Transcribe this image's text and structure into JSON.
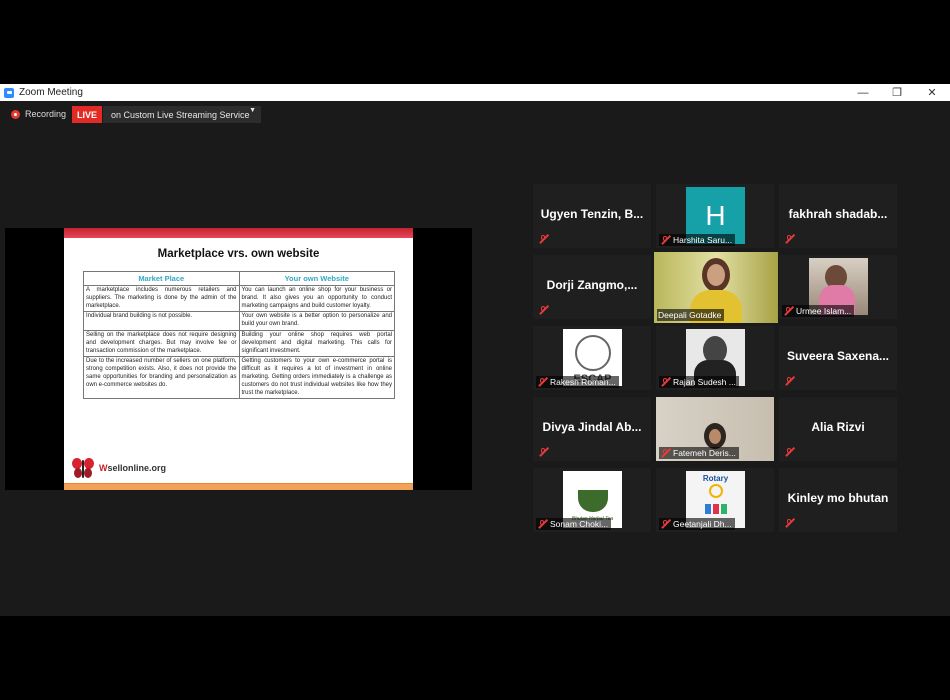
{
  "window": {
    "title": "Zoom Meeting"
  },
  "recording": {
    "label": "Recording",
    "live_badge": "LIVE",
    "stream_service": "on Custom Live Streaming Service"
  },
  "slide": {
    "title": "Marketplace vrs. own website",
    "columns": [
      "Market Place",
      "Your own Website"
    ],
    "rows": [
      [
        "A marketplace includes numerous retailers and suppliers. The marketing is done by the admin of the marketplace.",
        "You can launch an online shop for your business or brand. It also gives you an opportunity to conduct marketing campaigns and build customer loyalty."
      ],
      [
        "Individual brand building is not possible.",
        "Your own website is a better option to personalize and build your own brand."
      ],
      [
        "Selling on the marketplace does not require designing and development charges. But may involve fee or transaction commission of the marketplace.",
        "Building your online shop requires web portal development and digital marketing. This calls for significant investment."
      ],
      [
        "Due to the increased number of sellers on one platform, strong competition exists. Also, it does not provide the same opportunities for branding and personalization as own e-commerce websites do.",
        "Getting customers to your own e-commerce portal is difficult as it requires a lot of investment in online marketing. Getting orders immediately is a challenge as customers do not trust individual websites like how they trust the marketplace."
      ]
    ],
    "logo_prefix": "W",
    "logo_text": "sellonline.org"
  },
  "participants": [
    {
      "name": "Ugyen Tenzin, B...",
      "display": "name",
      "muted": true
    },
    {
      "name": "Harshita Saru...",
      "display": "avatar",
      "initial": "H",
      "avatar_color": "#16a1a8",
      "muted": true
    },
    {
      "name": "fakhrah shadab...",
      "display": "name",
      "muted": true
    },
    {
      "name": "Dorji Zangmo,...",
      "display": "name",
      "muted": true
    },
    {
      "name": "Deepali Gotadke",
      "display": "video",
      "muted": false,
      "speaking": true
    },
    {
      "name": "Urmee Islam...",
      "display": "photo",
      "muted": true
    },
    {
      "name": "Rakesh Roman...",
      "display": "logo",
      "logo_text": "ESCAP",
      "muted": true
    },
    {
      "name": "Rajan Sudesh ...",
      "display": "photo",
      "muted": true
    },
    {
      "name": "Suveera Saxena...",
      "display": "name",
      "muted": true
    },
    {
      "name": "Divya Jindal Ab...",
      "display": "name",
      "muted": true
    },
    {
      "name": "Fatemeh Deris...",
      "display": "video",
      "muted": true
    },
    {
      "name": "Alia Rizvi",
      "display": "name",
      "muted": true
    },
    {
      "name": "Sonam Choki...",
      "display": "logo",
      "logo_text": "Bhutan Herbal Tea",
      "muted": true
    },
    {
      "name": "Geetanjali Dh...",
      "display": "logo",
      "logo_text": "Rotary",
      "muted": true
    },
    {
      "name": "Kinley mo bhutan",
      "display": "name",
      "muted": true
    }
  ]
}
